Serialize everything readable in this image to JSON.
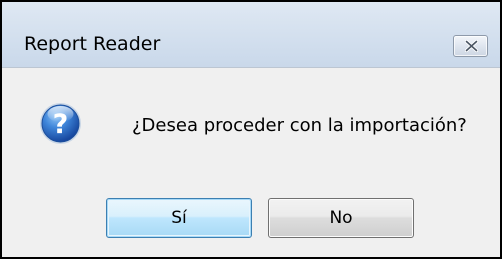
{
  "dialog": {
    "title": "Report Reader",
    "message": "¿Desea proceder con la importación?",
    "icon": "question-icon",
    "buttons": {
      "yes_label": "Sí",
      "no_label": "No"
    },
    "close_icon": "close-icon"
  },
  "colors": {
    "title_bar": "#d5e1ef",
    "dialog_background": "#f0f0f0",
    "focused_button_border": "#3c7fb1",
    "icon_blue": "#2d6bc4"
  }
}
